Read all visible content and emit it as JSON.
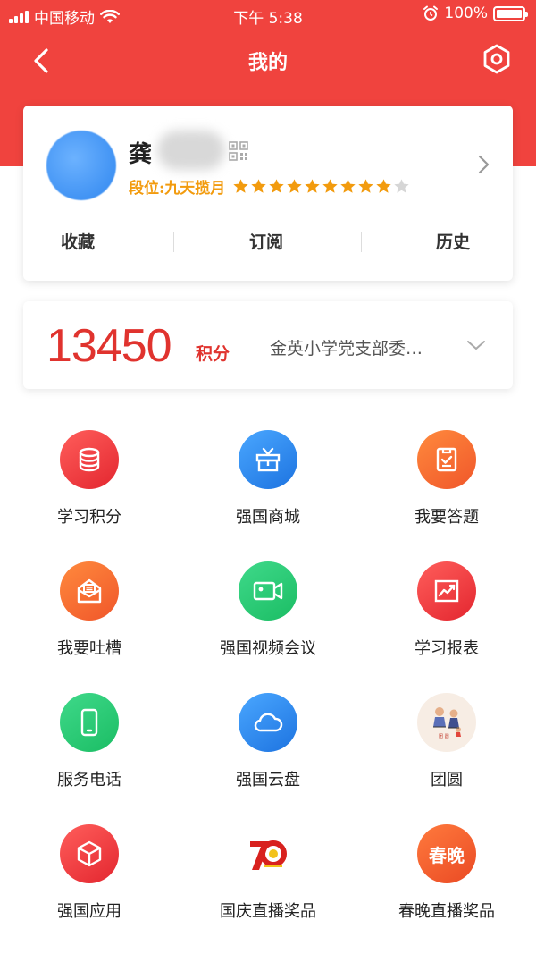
{
  "status_bar": {
    "carrier": "中国移动",
    "time": "下午 5:38",
    "battery": "100%"
  },
  "nav": {
    "title": "我的"
  },
  "profile": {
    "name": "龚",
    "rank": "段位:九天揽月",
    "stars_filled": 9,
    "stars_total": 10,
    "tabs": [
      "收藏",
      "订阅",
      "历史"
    ]
  },
  "score": {
    "value": "13450",
    "unit": "积分",
    "org": "金英小学党支部委…"
  },
  "grid": [
    {
      "label": "学习积分",
      "icon": "database-icon"
    },
    {
      "label": "强国商城",
      "icon": "gift-box-icon"
    },
    {
      "label": "我要答题",
      "icon": "clipboard-check-icon"
    },
    {
      "label": "我要吐槽",
      "icon": "envelope-open-icon"
    },
    {
      "label": "强国视频会议",
      "icon": "video-camera-icon"
    },
    {
      "label": "学习报表",
      "icon": "chart-trend-icon"
    },
    {
      "label": "服务电话",
      "icon": "mobile-phone-icon"
    },
    {
      "label": "强国云盘",
      "icon": "cloud-icon"
    },
    {
      "label": "团圆",
      "icon": "family-illustration-icon"
    },
    {
      "label": "强国应用",
      "icon": "cube-icon"
    },
    {
      "label": "国庆直播奖品",
      "icon": "seventy-anniversary-logo-icon"
    },
    {
      "label": "春晚直播奖品",
      "icon": "chunwan-icon",
      "icon_text": "春晚"
    }
  ],
  "colors": {
    "header_red": "#f0433e",
    "score_red": "#e0332e",
    "rank_gold": "#f29b0e",
    "star_empty": "#d6d6d6"
  }
}
